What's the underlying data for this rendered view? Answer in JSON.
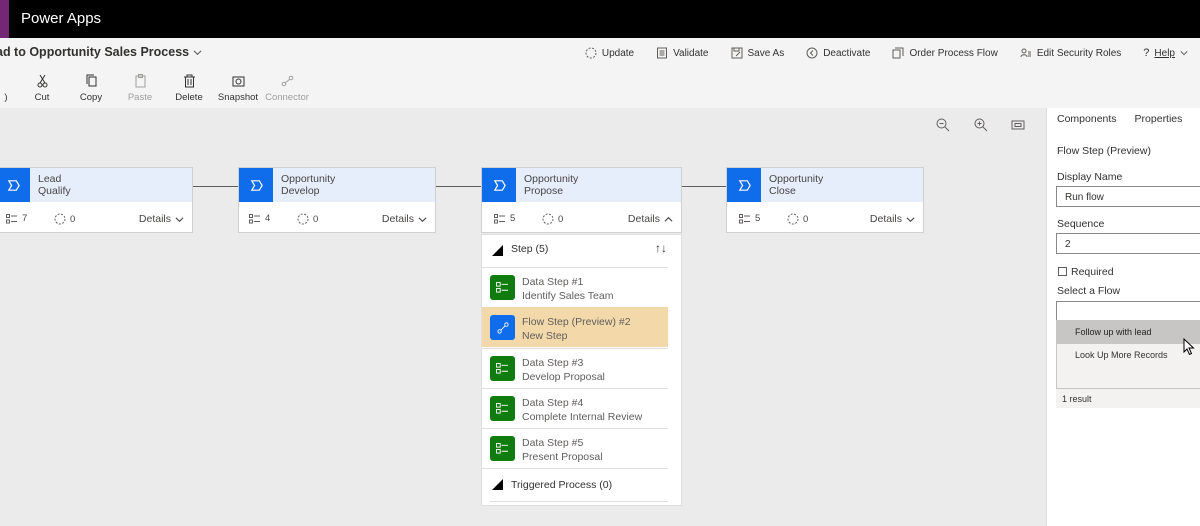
{
  "app": {
    "title": "Power Apps",
    "accent": "#742774"
  },
  "process": {
    "title": "ad to Opportunity Sales Process"
  },
  "top_commands": [
    {
      "label": "Update",
      "icon": "update-icon"
    },
    {
      "label": "Validate",
      "icon": "validate-icon"
    },
    {
      "label": "Save As",
      "icon": "save-as-icon"
    },
    {
      "label": "Deactivate",
      "icon": "deactivate-icon"
    },
    {
      "label": "Order Process Flow",
      "icon": "order-flow-icon"
    },
    {
      "label": "Edit Security Roles",
      "icon": "security-roles-icon"
    },
    {
      "label": "Help",
      "icon": "help-icon"
    }
  ],
  "toolbar": [
    {
      "label": "Cut",
      "icon": "cut-icon",
      "enabled": true
    },
    {
      "label": "Copy",
      "icon": "copy-icon",
      "enabled": true
    },
    {
      "label": "Paste",
      "icon": "paste-icon",
      "enabled": false
    },
    {
      "label": "Delete",
      "icon": "delete-icon",
      "enabled": true
    },
    {
      "label": "Snapshot",
      "icon": "snapshot-icon",
      "enabled": true
    },
    {
      "label": "Connector",
      "icon": "connector-icon",
      "enabled": false
    }
  ],
  "stages": [
    {
      "entity": "Lead",
      "name": "Qualify",
      "steps": "7",
      "flows": "0",
      "details": "Details"
    },
    {
      "entity": "Opportunity",
      "name": "Develop",
      "steps": "4",
      "flows": "0",
      "details": "Details"
    },
    {
      "entity": "Opportunity",
      "name": "Propose",
      "steps": "5",
      "flows": "0",
      "details": "Details"
    },
    {
      "entity": "Opportunity",
      "name": "Close",
      "steps": "5",
      "flows": "0",
      "details": "Details"
    }
  ],
  "step_list": {
    "header": "Step (5)",
    "items": [
      {
        "title": "Data Step #1",
        "subtitle": "Identify Sales Team",
        "kind": "data",
        "selected": false
      },
      {
        "title": "Flow Step (Preview) #2",
        "subtitle": "New Step",
        "kind": "flow",
        "selected": true
      },
      {
        "title": "Data Step #3",
        "subtitle": "Develop Proposal",
        "kind": "data",
        "selected": false
      },
      {
        "title": "Data Step #4",
        "subtitle": "Complete Internal Review",
        "kind": "data",
        "selected": false
      },
      {
        "title": "Data Step #5",
        "subtitle": "Present Proposal",
        "kind": "data",
        "selected": false
      }
    ],
    "triggered": "Triggered Process (0)"
  },
  "panel": {
    "tabs": [
      "Components",
      "Properties"
    ],
    "active_tab": "Properties",
    "section_title": "Flow Step (Preview)",
    "display_name_label": "Display Name",
    "display_name_value": "Run flow",
    "sequence_label": "Sequence",
    "sequence_value": "2",
    "required_label": "Required",
    "required_checked": false,
    "select_flow_label": "Select a Flow",
    "select_flow_value": "",
    "flow_options": [
      "Follow up with lead",
      "Look Up More Records"
    ],
    "highlighted_option": "Follow up with lead",
    "result_count": "1 result"
  },
  "colors": {
    "stage_icon": "#0f6cea",
    "data_step": "#107c10",
    "flow_step": "#0f6cea",
    "selected_step": "#f3d9a9"
  }
}
